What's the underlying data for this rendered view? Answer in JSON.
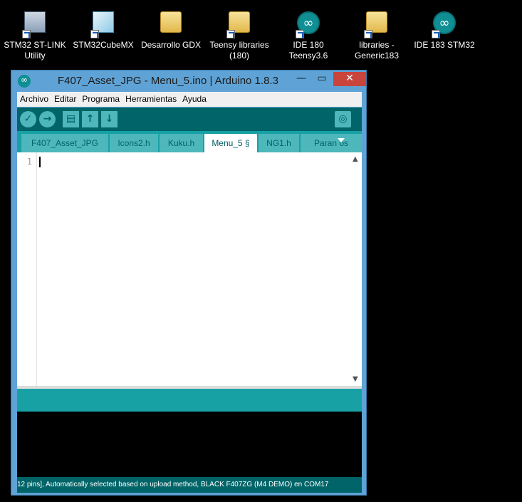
{
  "desktop": {
    "icons": [
      {
        "label": "STM32 ST-LINK\nUtility",
        "line1": "STM32 ST-LINK",
        "line2": "Utility",
        "icon": "stlink-icon"
      },
      {
        "label": "STM32CubeMX",
        "line1": "STM32CubeMX",
        "line2": "",
        "icon": "cube-icon"
      },
      {
        "label": "Desarrollo GDX",
        "line1": "Desarrollo GDX",
        "line2": "",
        "icon": "folder-icon"
      },
      {
        "label": "Teensy libraries (180)",
        "line1": "Teensy libraries",
        "line2": "(180)",
        "icon": "folder-shortcut-icon"
      },
      {
        "label": "IDE 180 Teensy3.6",
        "line1": "IDE 180",
        "line2": "Teensy3.6",
        "icon": "arduino-icon"
      },
      {
        "label": "libraries - Generic183",
        "line1": "libraries -",
        "line2": "Generic183",
        "icon": "folder-shortcut-icon"
      },
      {
        "label": "IDE 183 STM32",
        "line1": "IDE 183 STM32",
        "line2": "",
        "icon": "arduino-icon"
      }
    ]
  },
  "window": {
    "title": "F407_Asset_JPG - Menu_5.ino | Arduino 1.8.3",
    "min_glyph": "—",
    "max_glyph": "▭",
    "close_glyph": "✕"
  },
  "menu": {
    "items": [
      "Archivo",
      "Editar",
      "Programa",
      "Herramientas",
      "Ayuda"
    ]
  },
  "toolbar": {
    "verify_glyph": "✓",
    "upload_glyph": "→",
    "new_glyph": "▤",
    "open_glyph": "↑",
    "save_glyph": "↓",
    "serial_glyph": "◎"
  },
  "tabs": {
    "items": [
      "F407_Asset_JPG",
      "Icons2.h",
      "Kuku.h",
      "Menu_5 §",
      "NG1.h",
      "Paran   os"
    ],
    "active_index": 3
  },
  "editor": {
    "line_number": "1",
    "scroll_up": "▲",
    "scroll_down": "▼"
  },
  "status": {
    "text": "12 pins], Automatically selected based on upload method, BLACK F407ZG (M4 DEMO) en COM17"
  },
  "colors": {
    "teal_dark": "#006468",
    "teal_mid": "#17a1a5",
    "teal_light": "#4db7bb",
    "title_blue": "#5fa3d6",
    "close_red": "#c9453c"
  }
}
